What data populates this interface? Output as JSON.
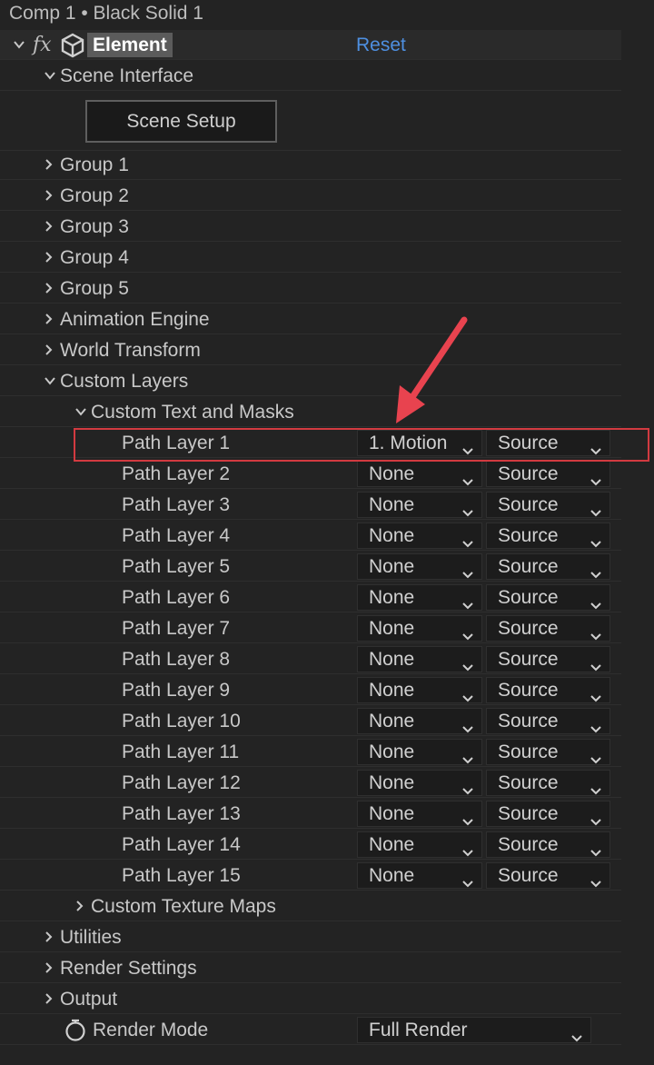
{
  "window": {
    "title": "Comp 1 • Black Solid 1"
  },
  "effect": {
    "fx": "fx",
    "name": "Element",
    "reset": "Reset"
  },
  "scene_interface": {
    "label": "Scene Interface",
    "button": "Scene Setup"
  },
  "groups": [
    "Group 1",
    "Group 2",
    "Group 3",
    "Group 4",
    "Group 5",
    "Animation Engine",
    "World Transform"
  ],
  "custom_layers": {
    "label": "Custom Layers",
    "text_masks": "Custom Text and Masks",
    "texture_maps": "Custom Texture Maps"
  },
  "path_layers": [
    {
      "label": "Path Layer 1",
      "layer": "1. Motion",
      "mode": "Source"
    },
    {
      "label": "Path Layer 2",
      "layer": "None",
      "mode": "Source"
    },
    {
      "label": "Path Layer 3",
      "layer": "None",
      "mode": "Source"
    },
    {
      "label": "Path Layer 4",
      "layer": "None",
      "mode": "Source"
    },
    {
      "label": "Path Layer 5",
      "layer": "None",
      "mode": "Source"
    },
    {
      "label": "Path Layer 6",
      "layer": "None",
      "mode": "Source"
    },
    {
      "label": "Path Layer 7",
      "layer": "None",
      "mode": "Source"
    },
    {
      "label": "Path Layer 8",
      "layer": "None",
      "mode": "Source"
    },
    {
      "label": "Path Layer 9",
      "layer": "None",
      "mode": "Source"
    },
    {
      "label": "Path Layer 10",
      "layer": "None",
      "mode": "Source"
    },
    {
      "label": "Path Layer 11",
      "layer": "None",
      "mode": "Source"
    },
    {
      "label": "Path Layer 12",
      "layer": "None",
      "mode": "Source"
    },
    {
      "label": "Path Layer 13",
      "layer": "None",
      "mode": "Source"
    },
    {
      "label": "Path Layer 14",
      "layer": "None",
      "mode": "Source"
    },
    {
      "label": "Path Layer 15",
      "layer": "None",
      "mode": "Source"
    }
  ],
  "bottom_groups": [
    "Utilities",
    "Render Settings",
    "Output"
  ],
  "render_mode": {
    "label": "Render Mode",
    "value": "Full Render"
  },
  "colors": {
    "background": "#232323",
    "link": "#4e8fe0",
    "highlight": "#d23a40",
    "element_tag": "#5b5b5b"
  },
  "icons": [
    "chevron-down-icon",
    "chevron-right-icon",
    "fx-icon",
    "cube-icon",
    "stopwatch-icon",
    "dropdown-caret-icon",
    "annotation-arrow-icon"
  ]
}
